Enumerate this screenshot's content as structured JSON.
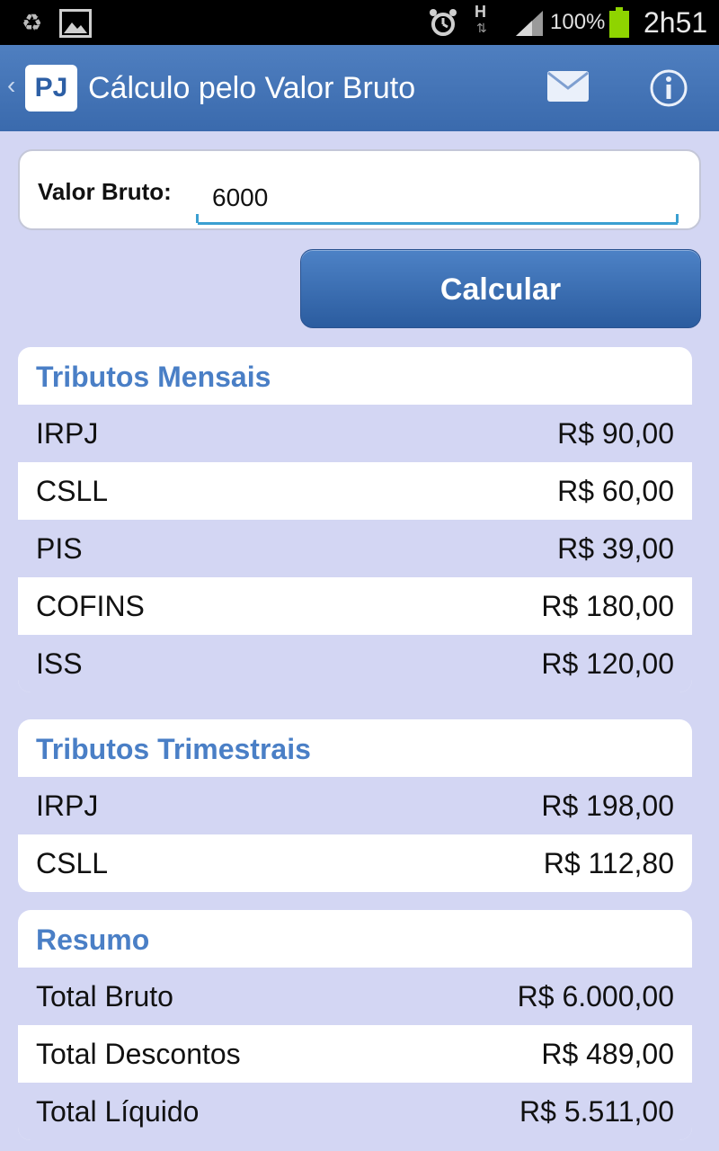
{
  "status_bar": {
    "battery_percent": "100%",
    "time": "2h51",
    "network_type": "H",
    "icons": [
      "recycle-icon",
      "image-icon",
      "alarm-icon",
      "data-arrows-icon",
      "signal-icon",
      "battery-icon"
    ]
  },
  "action_bar": {
    "logo_text": "PJ",
    "title": "Cálculo pelo Valor Bruto",
    "icons": [
      "back-chevron-icon",
      "mail-icon",
      "info-icon"
    ]
  },
  "form": {
    "label": "Valor Bruto:",
    "value": "6000",
    "button_label": "Calcular"
  },
  "sections": {
    "mensais": {
      "title": "Tributos Mensais",
      "rows": [
        {
          "name": "IRPJ",
          "value": "R$ 90,00"
        },
        {
          "name": "CSLL",
          "value": "R$ 60,00"
        },
        {
          "name": "PIS",
          "value": "R$ 39,00"
        },
        {
          "name": "COFINS",
          "value": "R$ 180,00"
        },
        {
          "name": "ISS",
          "value": "R$ 120,00"
        }
      ]
    },
    "trimestrais": {
      "title": "Tributos Trimestrais",
      "rows": [
        {
          "name": "IRPJ",
          "value": "R$ 198,00"
        },
        {
          "name": "CSLL",
          "value": "R$ 112,80"
        }
      ]
    },
    "resumo": {
      "title": "Resumo",
      "rows": [
        {
          "name": "Total Bruto",
          "value": "R$ 6.000,00"
        },
        {
          "name": "Total Descontos",
          "value": "R$ 489,00"
        },
        {
          "name": "Total Líquido",
          "value": "R$ 5.511,00"
        }
      ]
    }
  },
  "colors": {
    "background": "#d3d6f3",
    "action_bar": "#4474b8",
    "section_title": "#4a7fc6",
    "input_underline": "#3a9fd1",
    "button": "#3a6db2"
  }
}
